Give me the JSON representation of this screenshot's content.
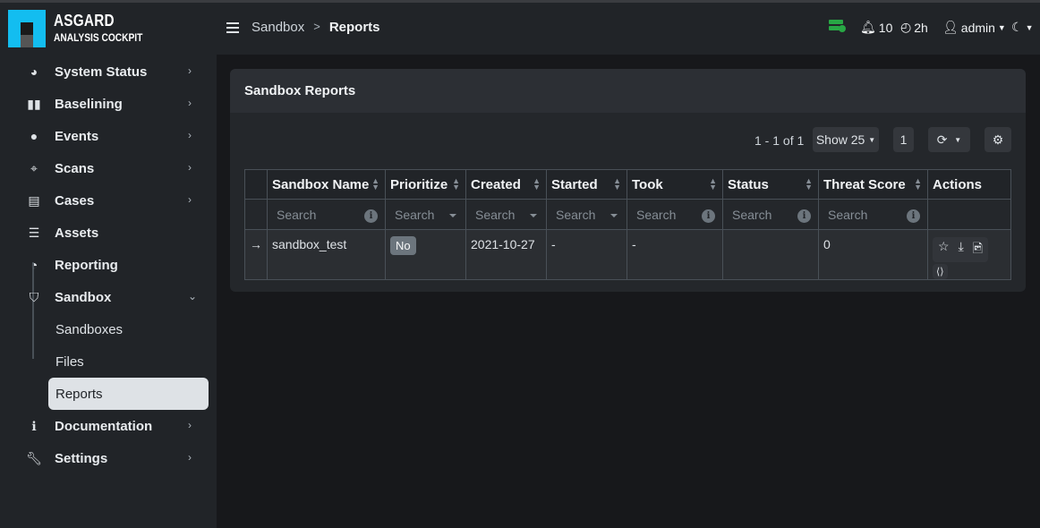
{
  "brand": {
    "title": "ASGARD",
    "subtitle": "ANALYSIS COCKPIT"
  },
  "sidebar": {
    "items": [
      {
        "label": "System Status",
        "icon": "gauge-icon"
      },
      {
        "label": "Baselining",
        "icon": "book-icon"
      },
      {
        "label": "Events",
        "icon": "reader-icon"
      },
      {
        "label": "Scans",
        "icon": "crosshair-icon"
      },
      {
        "label": "Cases",
        "icon": "case-book-icon"
      },
      {
        "label": "Assets",
        "icon": "server-icon"
      },
      {
        "label": "Reporting",
        "icon": "pie-chart-icon"
      },
      {
        "label": "Sandbox",
        "icon": "shield-icon"
      },
      {
        "label": "Documentation",
        "icon": "info-icon"
      },
      {
        "label": "Settings",
        "icon": "wrench-icon"
      }
    ],
    "sandbox_sub": [
      "Sandboxes",
      "Files",
      "Reports"
    ]
  },
  "header": {
    "breadcrumb": [
      "Sandbox",
      "Reports"
    ],
    "separator": ">",
    "notifications": "10",
    "timer": "2h",
    "user": "admin",
    "status_color": "#28a745"
  },
  "card": {
    "title": "Sandbox Reports",
    "pagination": "1 - 1 of 1",
    "show": "Show 25",
    "page": "1"
  },
  "table": {
    "columns": [
      "Sandbox Name",
      "Prioritize",
      "Created",
      "Started",
      "Took",
      "Status",
      "Threat Score",
      "Actions"
    ],
    "search_placeholder": "Search",
    "rows": [
      {
        "name": "sandbox_test",
        "prioritize": "No",
        "created": "2021-10-27",
        "started": "-",
        "took": "-",
        "status": "",
        "threat_score": "0"
      }
    ]
  }
}
